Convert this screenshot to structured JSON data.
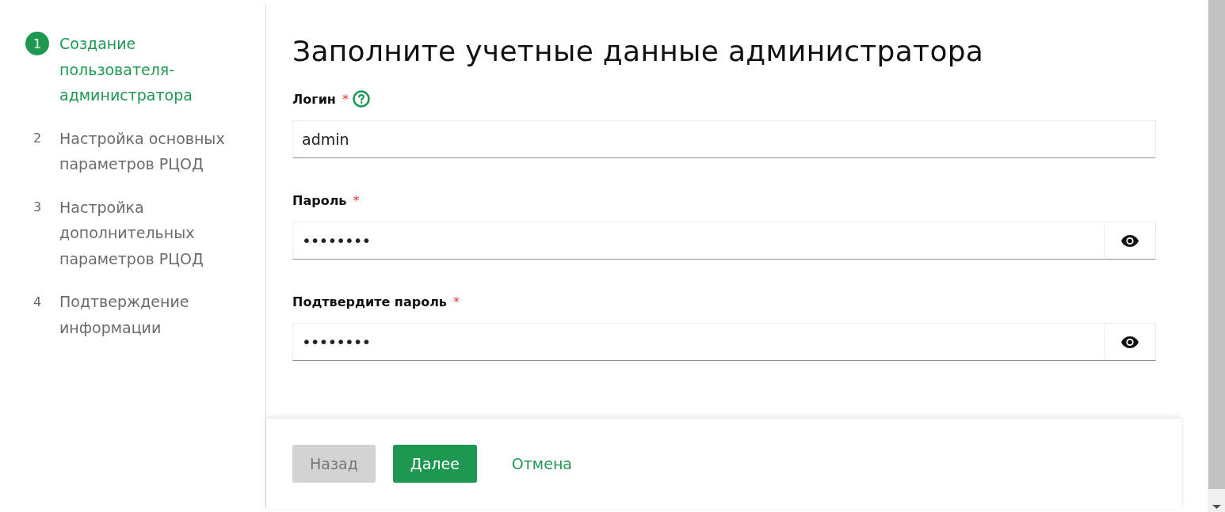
{
  "steps": [
    {
      "number": "1",
      "label": "Создание пользователя-администратора",
      "selected": true
    },
    {
      "number": "2",
      "label": "Настройка основных параметров РЦОД",
      "selected": false
    },
    {
      "number": "3",
      "label": "Настройка дополнительных параметров РЦОД",
      "selected": false
    },
    {
      "number": "4",
      "label": "Подтверждение информации",
      "selected": false
    }
  ],
  "title": "Заполните учетные данные администратора",
  "fields": [
    {
      "kind": "text",
      "label": "Логин",
      "required_mark": "*",
      "help": true,
      "value": "admin"
    },
    {
      "kind": "password",
      "label": "Пароль",
      "required_mark": "*",
      "help": false,
      "value": "••••••••"
    },
    {
      "kind": "password",
      "label": "Подтвердите пароль",
      "required_mark": "*",
      "help": false,
      "value": "••••••••"
    }
  ],
  "buttons": [
    {
      "kind": "secondary",
      "label": "Назад",
      "disabled": true
    },
    {
      "kind": "primary",
      "label": "Далее",
      "disabled": false
    },
    {
      "kind": "link",
      "label": "Отмена",
      "disabled": false
    }
  ]
}
